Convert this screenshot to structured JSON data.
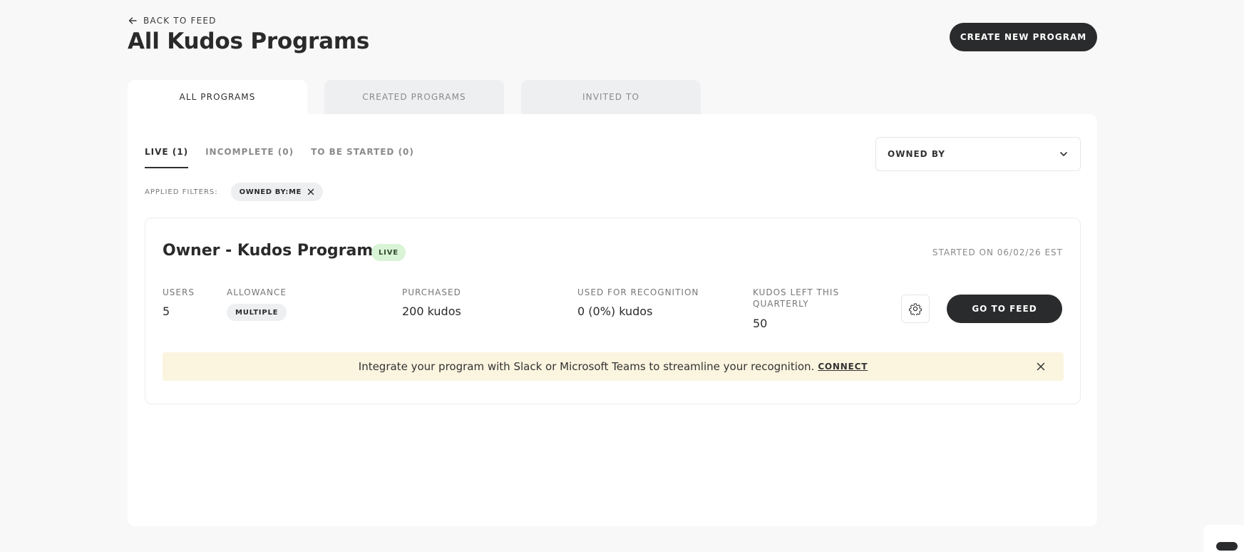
{
  "header": {
    "back_label": "BACK TO FEED",
    "title": "All Kudos Programs",
    "create_label": "CREATE NEW PROGRAM"
  },
  "tabs": [
    {
      "label": "ALL PROGRAMS",
      "active": true
    },
    {
      "label": "CREATED PROGRAMS",
      "active": false
    },
    {
      "label": "INVITED TO",
      "active": false
    }
  ],
  "subtabs": [
    {
      "label": "LIVE (1)",
      "active": true
    },
    {
      "label": "INCOMPLETE (0)",
      "active": false
    },
    {
      "label": "TO BE STARTED (0)",
      "active": false
    }
  ],
  "owned_by": {
    "label": "OWNED BY"
  },
  "filters": {
    "label": "APPLIED FILTERS:",
    "chips": [
      {
        "label": "OWNED BY:ME"
      }
    ]
  },
  "program": {
    "title": "Owner - Kudos Program",
    "status": "LIVE",
    "started": "STARTED ON 06/02/26 EST",
    "stats": {
      "users_label": "USERS",
      "users_value": "5",
      "allowance_label": "ALLOWANCE",
      "allowance_value": "MULTIPLE",
      "purchased_label": "PURCHASED",
      "purchased_value": "200 kudos",
      "used_label": "USED FOR RECOGNITION",
      "used_value": "0 (0%) kudos",
      "left_label_line1": "KUDOS LEFT THIS",
      "left_label_line2": "QUARTERLY",
      "left_value": "50"
    },
    "feed_label": "GO TO FEED"
  },
  "banner": {
    "text": "Integrate your program with Slack or Microsoft Teams to streamline your recognition.",
    "connect_label": "CONNECT"
  },
  "colors": {
    "accent_dark": "#2a2b2c",
    "live_badge_bg": "#d8f3d6",
    "banner_bg": "#fbf4df",
    "page_bg": "#f8f8f8"
  }
}
